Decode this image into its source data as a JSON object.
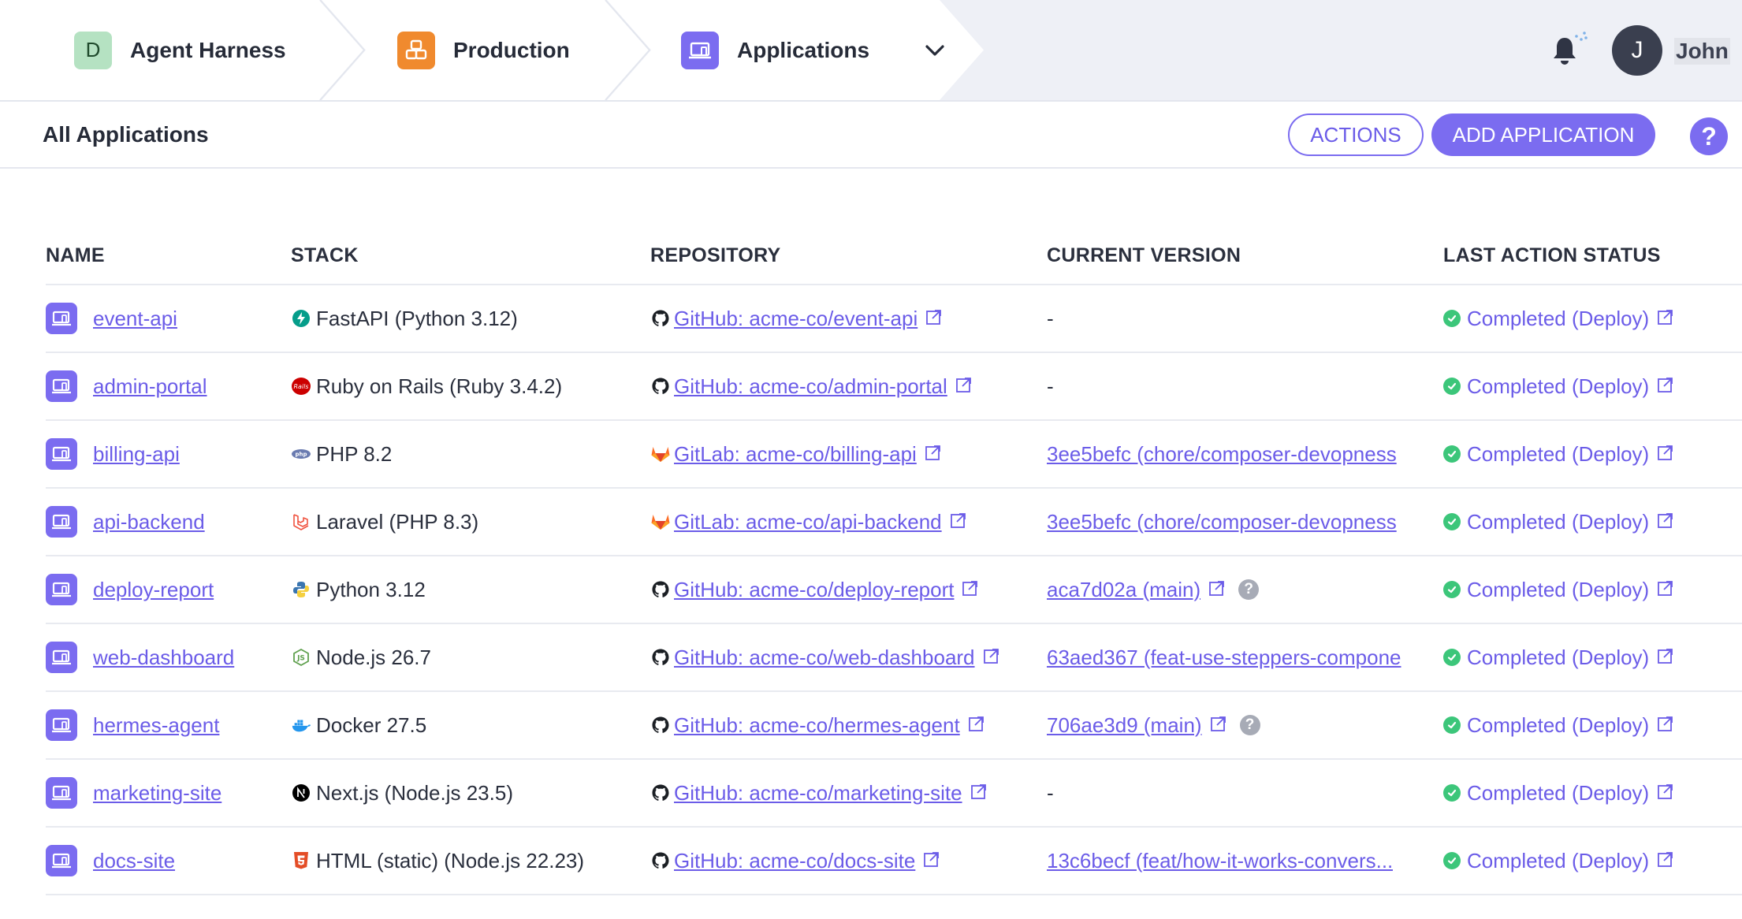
{
  "breadcrumbs": [
    {
      "badge": "D",
      "label": "Agent Harness"
    },
    {
      "badge": "",
      "label": "Production"
    },
    {
      "badge": "",
      "label": "Applications"
    }
  ],
  "user": {
    "initial": "J",
    "name": "John"
  },
  "header": {
    "title": "All Applications",
    "actions_label": "ACTIONS",
    "add_label": "ADD APPLICATION",
    "help_label": "?"
  },
  "columns": [
    "NAME",
    "STACK",
    "REPOSITORY",
    "CURRENT VERSION",
    "LAST ACTION STATUS"
  ],
  "rows": [
    {
      "name": "event-api",
      "stack": "FastAPI (Python 3.12)",
      "stack_icon": "fastapi-icon",
      "repo": "GitHub: acme-co/event-api",
      "repo_icon": "github-icon",
      "version": "-",
      "status": "Completed (Deploy)"
    },
    {
      "name": "admin-portal",
      "stack": "Ruby on Rails (Ruby 3.4.2)",
      "stack_icon": "rails-icon",
      "repo": "GitHub: acme-co/admin-portal",
      "repo_icon": "github-icon",
      "version": "-",
      "status": "Completed (Deploy)"
    },
    {
      "name": "billing-api",
      "stack": "PHP 8.2",
      "stack_icon": "php-icon",
      "repo": "GitLab: acme-co/billing-api",
      "repo_icon": "gitlab-icon",
      "version": "3ee5befc (chore/composer-devopness",
      "status": "Completed (Deploy)"
    },
    {
      "name": "api-backend",
      "stack": "Laravel (PHP 8.3)",
      "stack_icon": "laravel-icon",
      "repo": "GitLab: acme-co/api-backend",
      "repo_icon": "gitlab-icon",
      "version": "3ee5befc (chore/composer-devopness",
      "status": "Completed (Deploy)"
    },
    {
      "name": "deploy-report",
      "stack": "Python 3.12",
      "stack_icon": "python-icon",
      "repo": "GitHub: acme-co/deploy-report",
      "repo_icon": "github-icon",
      "version": "aca7d02a (main)",
      "status": "Completed (Deploy)"
    },
    {
      "name": "web-dashboard",
      "stack": "Node.js 26.7",
      "stack_icon": "nodejs-icon",
      "repo": "GitHub: acme-co/web-dashboard",
      "repo_icon": "github-icon",
      "version": "63aed367 (feat-use-steppers-compone",
      "status": "Completed (Deploy)"
    },
    {
      "name": "hermes-agent",
      "stack": "Docker 27.5",
      "stack_icon": "docker-icon",
      "repo": "GitHub: acme-co/hermes-agent",
      "repo_icon": "github-icon",
      "version": "706ae3d9 (main)",
      "status": "Completed (Deploy)"
    },
    {
      "name": "marketing-site",
      "stack": "Next.js (Node.js 23.5)",
      "stack_icon": "nextjs-icon",
      "repo": "GitHub: acme-co/marketing-site",
      "repo_icon": "github-icon",
      "version": "-",
      "status": "Completed (Deploy)"
    },
    {
      "name": "docs-site",
      "stack": "HTML (static) (Node.js 22.23)",
      "stack_icon": "html5-icon",
      "repo": "GitHub: acme-co/docs-site",
      "repo_icon": "github-icon",
      "version": "13c6becf (feat/how-it-works-convers...",
      "status": "Completed (Deploy)"
    }
  ],
  "colors": {
    "accent": "#7b6cf0",
    "success": "#3cc67a",
    "production": "#f08a2e",
    "org_badge": "#b5e2c2"
  }
}
